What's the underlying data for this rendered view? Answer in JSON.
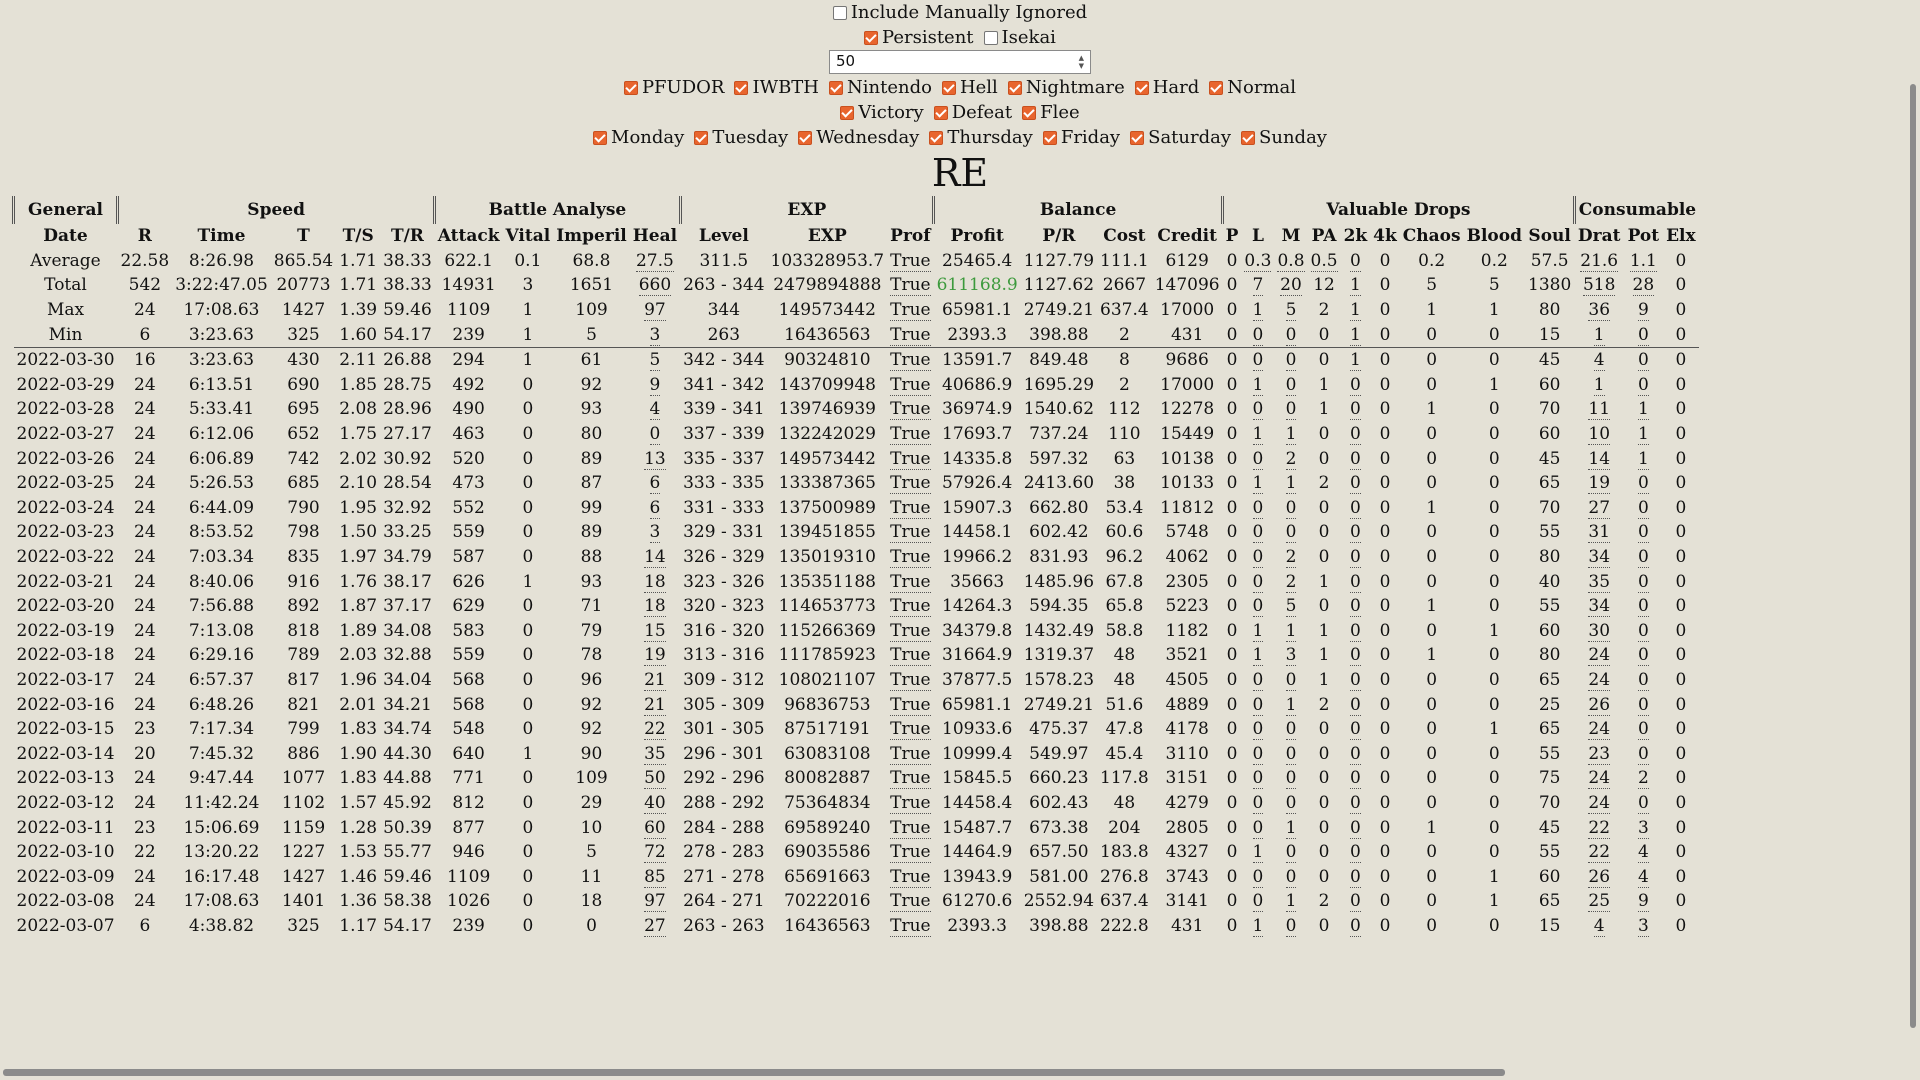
{
  "filters": {
    "include_manual": {
      "label": "Include Manually Ignored",
      "checked": false
    },
    "persistent": {
      "label": "Persistent",
      "checked": true
    },
    "isekai": {
      "label": "Isekai",
      "checked": false
    },
    "count_value": "50",
    "difficulties": [
      {
        "label": "PFUDOR",
        "checked": true
      },
      {
        "label": "IWBTH",
        "checked": true
      },
      {
        "label": "Nintendo",
        "checked": true
      },
      {
        "label": "Hell",
        "checked": true
      },
      {
        "label": "Nightmare",
        "checked": true
      },
      {
        "label": "Hard",
        "checked": true
      },
      {
        "label": "Normal",
        "checked": true
      }
    ],
    "outcomes": [
      {
        "label": "Victory",
        "checked": true
      },
      {
        "label": "Defeat",
        "checked": true
      },
      {
        "label": "Flee",
        "checked": true
      }
    ],
    "days": [
      {
        "label": "Monday",
        "checked": true
      },
      {
        "label": "Tuesday",
        "checked": true
      },
      {
        "label": "Wednesday",
        "checked": true
      },
      {
        "label": "Thursday",
        "checked": true
      },
      {
        "label": "Friday",
        "checked": true
      },
      {
        "label": "Saturday",
        "checked": true
      },
      {
        "label": "Sunday",
        "checked": true
      }
    ]
  },
  "title": "RE",
  "groups": [
    {
      "label": "General",
      "span": 1
    },
    {
      "label": "Speed",
      "span": 5
    },
    {
      "label": "Battle Analyse",
      "span": 4
    },
    {
      "label": "EXP",
      "span": 3
    },
    {
      "label": "Balance",
      "span": 4
    },
    {
      "label": "Valuable Drops",
      "span": 9
    },
    {
      "label": "Consumable",
      "span": 3
    }
  ],
  "columns": [
    "Date",
    "R",
    "Time",
    "T",
    "T/S",
    "T/R",
    "Attack",
    "Vital",
    "Imperil",
    "Heal",
    "Level",
    "EXP",
    "Prof",
    "Profit",
    "P/R",
    "Cost",
    "Credit",
    "P",
    "L",
    "M",
    "PA",
    "2k",
    "4k",
    "Chaos",
    "Blood",
    "Soul",
    "Drat",
    "Pot",
    "Elx"
  ],
  "summary": [
    [
      "Average",
      "22.58",
      "8:26.98",
      "865.54",
      "1.71",
      "38.33",
      "622.1",
      "0.1",
      "68.8",
      "27.5",
      "311.5",
      "103328953.7",
      "True",
      "25465.4",
      "1127.79",
      "111.1",
      "6129",
      "0",
      "0.3",
      "0.8",
      "0.5",
      "0",
      "0",
      "0.2",
      "0.2",
      "57.5",
      "21.6",
      "1.1",
      "0"
    ],
    [
      "Total",
      "542",
      "3:22:47.05",
      "20773",
      "1.71",
      "38.33",
      "14931",
      "3",
      "1651",
      "660",
      "263 - 344",
      "2479894888",
      "True",
      "611168.9",
      "1127.62",
      "2667",
      "147096",
      "0",
      "7",
      "20",
      "12",
      "1",
      "0",
      "5",
      "5",
      "1380",
      "518",
      "28",
      "0"
    ],
    [
      "Max",
      "24",
      "17:08.63",
      "1427",
      "1.39",
      "59.46",
      "1109",
      "1",
      "109",
      "97",
      "344",
      "149573442",
      "True",
      "65981.1",
      "2749.21",
      "637.4",
      "17000",
      "0",
      "1",
      "5",
      "2",
      "1",
      "0",
      "1",
      "1",
      "80",
      "36",
      "9",
      "0"
    ],
    [
      "Min",
      "6",
      "3:23.63",
      "325",
      "1.60",
      "54.17",
      "239",
      "1",
      "5",
      "3",
      "263",
      "16436563",
      "True",
      "2393.3",
      "398.88",
      "2",
      "431",
      "0",
      "0",
      "0",
      "0",
      "1",
      "0",
      "0",
      "0",
      "15",
      "1",
      "0",
      "0"
    ]
  ],
  "rows": [
    [
      "2022-03-30",
      "16",
      "3:23.63",
      "430",
      "2.11",
      "26.88",
      "294",
      "1",
      "61",
      "5",
      "342 - 344",
      "90324810",
      "True",
      "13591.7",
      "849.48",
      "8",
      "9686",
      "0",
      "0",
      "0",
      "0",
      "1",
      "0",
      "0",
      "0",
      "45",
      "4",
      "0",
      "0"
    ],
    [
      "2022-03-29",
      "24",
      "6:13.51",
      "690",
      "1.85",
      "28.75",
      "492",
      "0",
      "92",
      "9",
      "341 - 342",
      "143709948",
      "True",
      "40686.9",
      "1695.29",
      "2",
      "17000",
      "0",
      "1",
      "0",
      "1",
      "0",
      "0",
      "0",
      "1",
      "60",
      "1",
      "0",
      "0"
    ],
    [
      "2022-03-28",
      "24",
      "5:33.41",
      "695",
      "2.08",
      "28.96",
      "490",
      "0",
      "93",
      "4",
      "339 - 341",
      "139746939",
      "True",
      "36974.9",
      "1540.62",
      "112",
      "12278",
      "0",
      "0",
      "0",
      "1",
      "0",
      "0",
      "1",
      "0",
      "70",
      "11",
      "1",
      "0"
    ],
    [
      "2022-03-27",
      "24",
      "6:12.06",
      "652",
      "1.75",
      "27.17",
      "463",
      "0",
      "80",
      "0",
      "337 - 339",
      "132242029",
      "True",
      "17693.7",
      "737.24",
      "110",
      "15449",
      "0",
      "1",
      "1",
      "0",
      "0",
      "0",
      "0",
      "0",
      "60",
      "10",
      "1",
      "0"
    ],
    [
      "2022-03-26",
      "24",
      "6:06.89",
      "742",
      "2.02",
      "30.92",
      "520",
      "0",
      "89",
      "13",
      "335 - 337",
      "149573442",
      "True",
      "14335.8",
      "597.32",
      "63",
      "10138",
      "0",
      "0",
      "2",
      "0",
      "0",
      "0",
      "0",
      "0",
      "45",
      "14",
      "1",
      "0"
    ],
    [
      "2022-03-25",
      "24",
      "5:26.53",
      "685",
      "2.10",
      "28.54",
      "473",
      "0",
      "87",
      "6",
      "333 - 335",
      "133387365",
      "True",
      "57926.4",
      "2413.60",
      "38",
      "10133",
      "0",
      "1",
      "1",
      "2",
      "0",
      "0",
      "0",
      "0",
      "65",
      "19",
      "0",
      "0"
    ],
    [
      "2022-03-24",
      "24",
      "6:44.09",
      "790",
      "1.95",
      "32.92",
      "552",
      "0",
      "99",
      "6",
      "331 - 333",
      "137500989",
      "True",
      "15907.3",
      "662.80",
      "53.4",
      "11812",
      "0",
      "0",
      "0",
      "0",
      "0",
      "0",
      "1",
      "0",
      "70",
      "27",
      "0",
      "0"
    ],
    [
      "2022-03-23",
      "24",
      "8:53.52",
      "798",
      "1.50",
      "33.25",
      "559",
      "0",
      "89",
      "3",
      "329 - 331",
      "139451855",
      "True",
      "14458.1",
      "602.42",
      "60.6",
      "5748",
      "0",
      "0",
      "0",
      "0",
      "0",
      "0",
      "0",
      "0",
      "55",
      "31",
      "0",
      "0"
    ],
    [
      "2022-03-22",
      "24",
      "7:03.34",
      "835",
      "1.97",
      "34.79",
      "587",
      "0",
      "88",
      "14",
      "326 - 329",
      "135019310",
      "True",
      "19966.2",
      "831.93",
      "96.2",
      "4062",
      "0",
      "0",
      "2",
      "0",
      "0",
      "0",
      "0",
      "0",
      "80",
      "34",
      "0",
      "0"
    ],
    [
      "2022-03-21",
      "24",
      "8:40.06",
      "916",
      "1.76",
      "38.17",
      "626",
      "1",
      "93",
      "18",
      "323 - 326",
      "135351188",
      "True",
      "35663",
      "1485.96",
      "67.8",
      "2305",
      "0",
      "0",
      "2",
      "1",
      "0",
      "0",
      "0",
      "0",
      "40",
      "35",
      "0",
      "0"
    ],
    [
      "2022-03-20",
      "24",
      "7:56.88",
      "892",
      "1.87",
      "37.17",
      "629",
      "0",
      "71",
      "18",
      "320 - 323",
      "114653773",
      "True",
      "14264.3",
      "594.35",
      "65.8",
      "5223",
      "0",
      "0",
      "5",
      "0",
      "0",
      "0",
      "1",
      "0",
      "55",
      "34",
      "0",
      "0"
    ],
    [
      "2022-03-19",
      "24",
      "7:13.08",
      "818",
      "1.89",
      "34.08",
      "583",
      "0",
      "79",
      "15",
      "316 - 320",
      "115266369",
      "True",
      "34379.8",
      "1432.49",
      "58.8",
      "1182",
      "0",
      "1",
      "1",
      "1",
      "0",
      "0",
      "0",
      "1",
      "60",
      "30",
      "0",
      "0"
    ],
    [
      "2022-03-18",
      "24",
      "6:29.16",
      "789",
      "2.03",
      "32.88",
      "559",
      "0",
      "78",
      "19",
      "313 - 316",
      "111785923",
      "True",
      "31664.9",
      "1319.37",
      "48",
      "3521",
      "0",
      "1",
      "3",
      "1",
      "0",
      "0",
      "1",
      "0",
      "80",
      "24",
      "0",
      "0"
    ],
    [
      "2022-03-17",
      "24",
      "6:57.37",
      "817",
      "1.96",
      "34.04",
      "568",
      "0",
      "96",
      "21",
      "309 - 312",
      "108021107",
      "True",
      "37877.5",
      "1578.23",
      "48",
      "4505",
      "0",
      "0",
      "0",
      "1",
      "0",
      "0",
      "0",
      "0",
      "65",
      "24",
      "0",
      "0"
    ],
    [
      "2022-03-16",
      "24",
      "6:48.26",
      "821",
      "2.01",
      "34.21",
      "568",
      "0",
      "92",
      "21",
      "305 - 309",
      "96836753",
      "True",
      "65981.1",
      "2749.21",
      "51.6",
      "4889",
      "0",
      "0",
      "1",
      "2",
      "0",
      "0",
      "0",
      "0",
      "25",
      "26",
      "0",
      "0"
    ],
    [
      "2022-03-15",
      "23",
      "7:17.34",
      "799",
      "1.83",
      "34.74",
      "548",
      "0",
      "92",
      "22",
      "301 - 305",
      "87517191",
      "True",
      "10933.6",
      "475.37",
      "47.8",
      "4178",
      "0",
      "0",
      "0",
      "0",
      "0",
      "0",
      "0",
      "1",
      "65",
      "24",
      "0",
      "0"
    ],
    [
      "2022-03-14",
      "20",
      "7:45.32",
      "886",
      "1.90",
      "44.30",
      "640",
      "1",
      "90",
      "35",
      "296 - 301",
      "63083108",
      "True",
      "10999.4",
      "549.97",
      "45.4",
      "3110",
      "0",
      "0",
      "0",
      "0",
      "0",
      "0",
      "0",
      "0",
      "55",
      "23",
      "0",
      "0"
    ],
    [
      "2022-03-13",
      "24",
      "9:47.44",
      "1077",
      "1.83",
      "44.88",
      "771",
      "0",
      "109",
      "50",
      "292 - 296",
      "80082887",
      "True",
      "15845.5",
      "660.23",
      "117.8",
      "3151",
      "0",
      "0",
      "0",
      "0",
      "0",
      "0",
      "0",
      "0",
      "75",
      "24",
      "2",
      "0"
    ],
    [
      "2022-03-12",
      "24",
      "11:42.24",
      "1102",
      "1.57",
      "45.92",
      "812",
      "0",
      "29",
      "40",
      "288 - 292",
      "75364834",
      "True",
      "14458.4",
      "602.43",
      "48",
      "4279",
      "0",
      "0",
      "0",
      "0",
      "0",
      "0",
      "0",
      "0",
      "70",
      "24",
      "0",
      "0"
    ],
    [
      "2022-03-11",
      "23",
      "15:06.69",
      "1159",
      "1.28",
      "50.39",
      "877",
      "0",
      "10",
      "60",
      "284 - 288",
      "69589240",
      "True",
      "15487.7",
      "673.38",
      "204",
      "2805",
      "0",
      "0",
      "1",
      "0",
      "0",
      "0",
      "1",
      "0",
      "45",
      "22",
      "3",
      "0"
    ],
    [
      "2022-03-10",
      "22",
      "13:20.22",
      "1227",
      "1.53",
      "55.77",
      "946",
      "0",
      "5",
      "72",
      "278 - 283",
      "69035586",
      "True",
      "14464.9",
      "657.50",
      "183.8",
      "4327",
      "0",
      "1",
      "0",
      "0",
      "0",
      "0",
      "0",
      "0",
      "55",
      "22",
      "4",
      "0"
    ],
    [
      "2022-03-09",
      "24",
      "16:17.48",
      "1427",
      "1.46",
      "59.46",
      "1109",
      "0",
      "11",
      "85",
      "271 - 278",
      "65691663",
      "True",
      "13943.9",
      "581.00",
      "276.8",
      "3743",
      "0",
      "0",
      "0",
      "0",
      "0",
      "0",
      "0",
      "1",
      "60",
      "26",
      "4",
      "0"
    ],
    [
      "2022-03-08",
      "24",
      "17:08.63",
      "1401",
      "1.36",
      "58.38",
      "1026",
      "0",
      "18",
      "97",
      "264 - 271",
      "70222016",
      "True",
      "61270.6",
      "2552.94",
      "637.4",
      "3141",
      "0",
      "0",
      "1",
      "2",
      "0",
      "0",
      "0",
      "1",
      "65",
      "25",
      "9",
      "0"
    ],
    [
      "2022-03-07",
      "6",
      "4:38.82",
      "325",
      "1.17",
      "54.17",
      "239",
      "0",
      "0",
      "27",
      "263 - 263",
      "16436563",
      "True",
      "2393.3",
      "398.88",
      "222.8",
      "431",
      "0",
      "1",
      "0",
      "0",
      "0",
      "0",
      "0",
      "0",
      "15",
      "4",
      "3",
      "0"
    ]
  ],
  "colors": {
    "background": "#e4e1d6",
    "checkbox": "#e8652e",
    "total_profit": "#3c9a3c"
  }
}
